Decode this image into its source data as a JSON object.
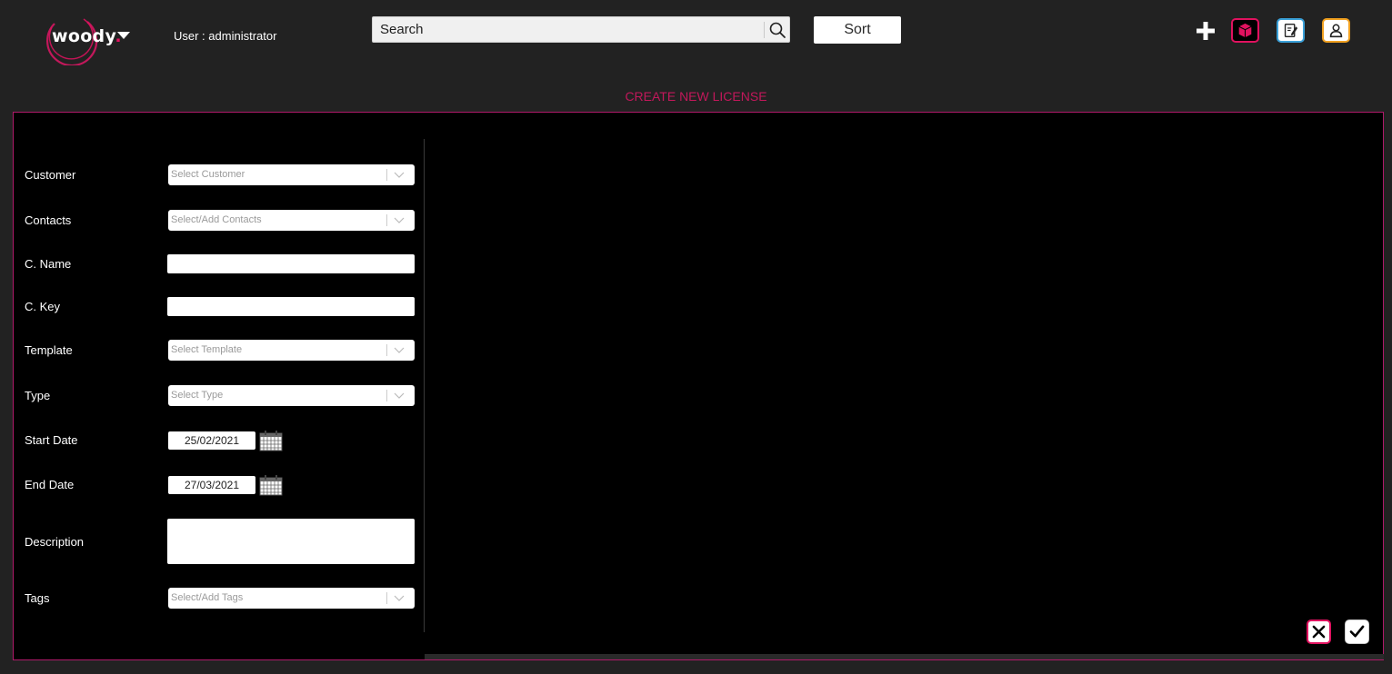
{
  "header": {
    "logo_text": "woody",
    "logo_dot": ".",
    "user_label": "User : administrator",
    "search_placeholder": "Search",
    "sort_label": "Sort",
    "icons": [
      "plus-icon",
      "cube-icon",
      "edit-icon",
      "user-icon"
    ]
  },
  "page_title": "CREATE NEW LICENSE",
  "form": {
    "customer": {
      "label": "Customer",
      "placeholder": "Select Customer"
    },
    "contacts": {
      "label": "Contacts",
      "placeholder": "Select/Add Contacts"
    },
    "c_name": {
      "label": "C. Name",
      "value": ""
    },
    "c_key": {
      "label": "C. Key",
      "value": ""
    },
    "template": {
      "label": "Template",
      "placeholder": "Select Template"
    },
    "type": {
      "label": "Type",
      "placeholder": "Select Type"
    },
    "start_date": {
      "label": "Start Date",
      "value": "25/02/2021"
    },
    "end_date": {
      "label": "End Date",
      "value": "27/03/2021"
    },
    "description": {
      "label": "Description",
      "value": ""
    },
    "tags": {
      "label": "Tags",
      "placeholder": "Select/Add Tags"
    }
  },
  "actions": {
    "cancel_icon": "close-icon",
    "confirm_icon": "check-icon"
  },
  "colors": {
    "accent": "#e0125f",
    "title": "#c2185b",
    "background": "#222222",
    "panel": "#000000",
    "panel_border": "#b01a6a"
  }
}
